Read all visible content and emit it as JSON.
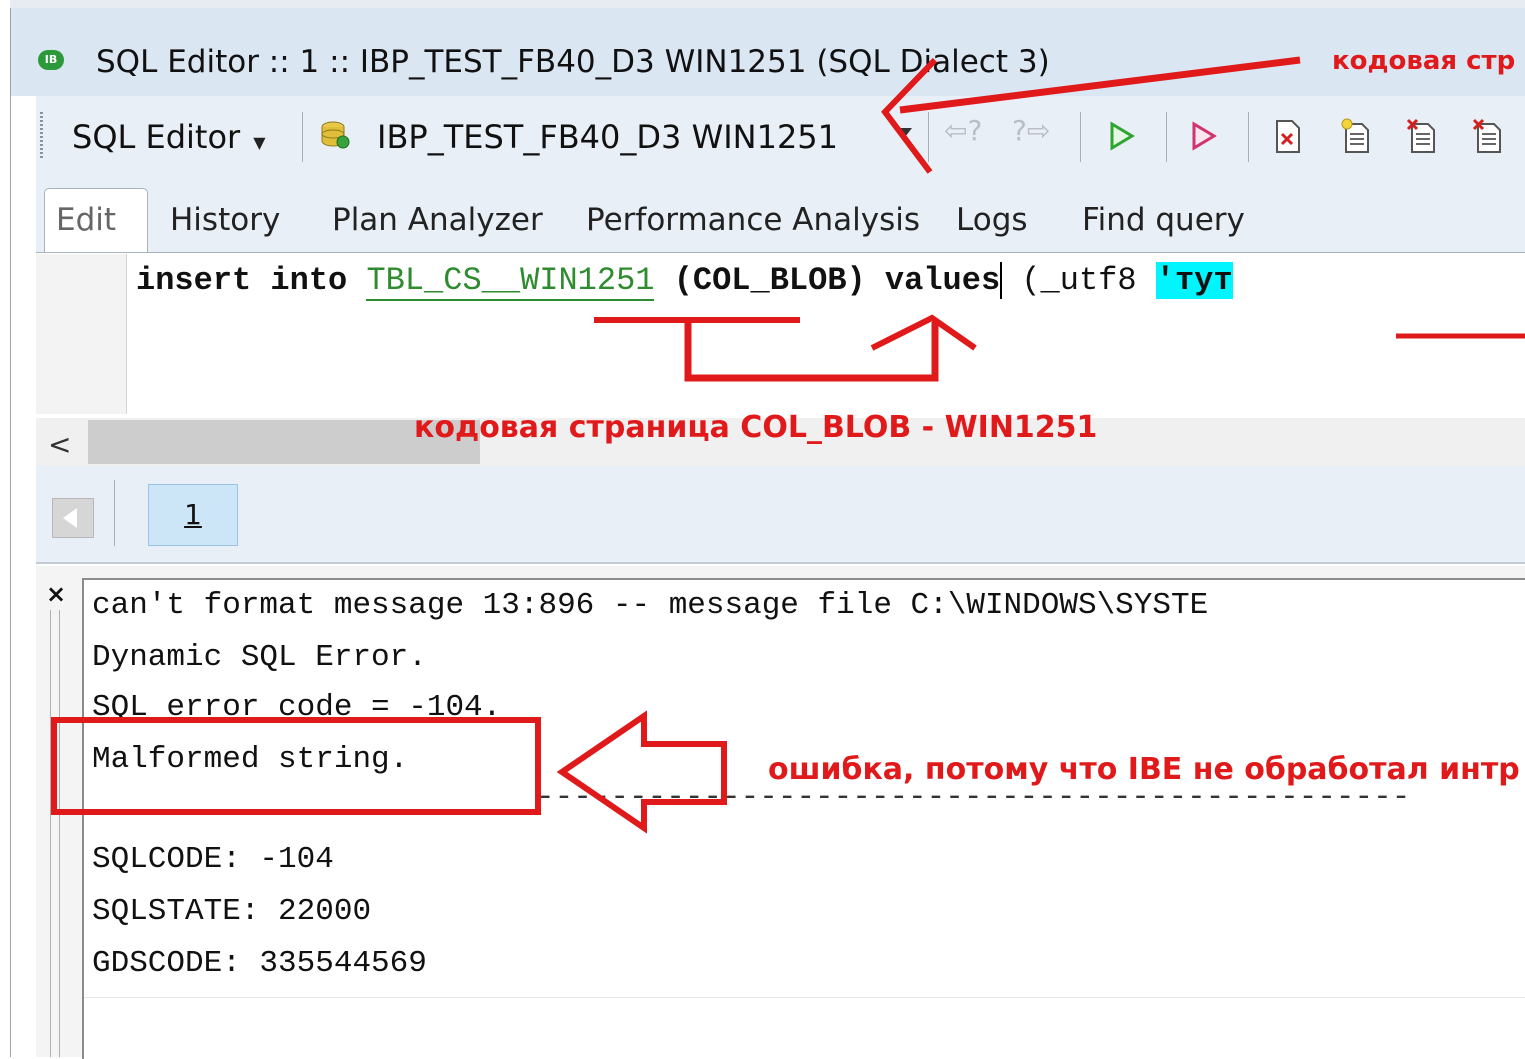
{
  "window": {
    "title": "SQL Editor :: 1 :: IBP_TEST_FB40_D3 WIN1251 (SQL Dialect 3)",
    "app_icon_text": "IB"
  },
  "toolbar": {
    "sql_editor_label": "SQL Editor",
    "database": "IBP_TEST_FB40_D3 WIN1251",
    "prev_statement": "⇦?",
    "next_statement": "?⇨"
  },
  "tabs": [
    {
      "label": "Edit",
      "active": true
    },
    {
      "label": "History"
    },
    {
      "label": "Plan Analyzer"
    },
    {
      "label": "Performance Analysis"
    },
    {
      "label": "Logs"
    },
    {
      "label": "Find query"
    }
  ],
  "editor": {
    "kw_insert": "insert into",
    "table_name": "TBL_CS__WIN1251",
    "columns": "(COL_BLOB)",
    "kw_values": "values",
    "after_cursor": " (_utf8",
    "string_literal": "'тут"
  },
  "hscroll": {
    "left_arrow": "<"
  },
  "results": {
    "page": "1"
  },
  "messages": {
    "close": "×",
    "lines": [
      "can't format message 13:896 -- message file C:\\WINDOWS\\SYSTE",
      "Dynamic SQL Error.",
      "SQL error code = -104.",
      "Malformed string.",
      "",
      "SQLCODE: -104",
      "SQLSTATE: 22000",
      "GDSCODE: 335544569"
    ],
    "separator": "-----------------------------------------------"
  },
  "annotations": {
    "top_right": "кодовая стр",
    "col_blob": "кодовая страница COL_BLOB - WIN1251",
    "error_note": "ошибка, потому что IBE не обработал интр",
    "color": "#e0191b"
  }
}
